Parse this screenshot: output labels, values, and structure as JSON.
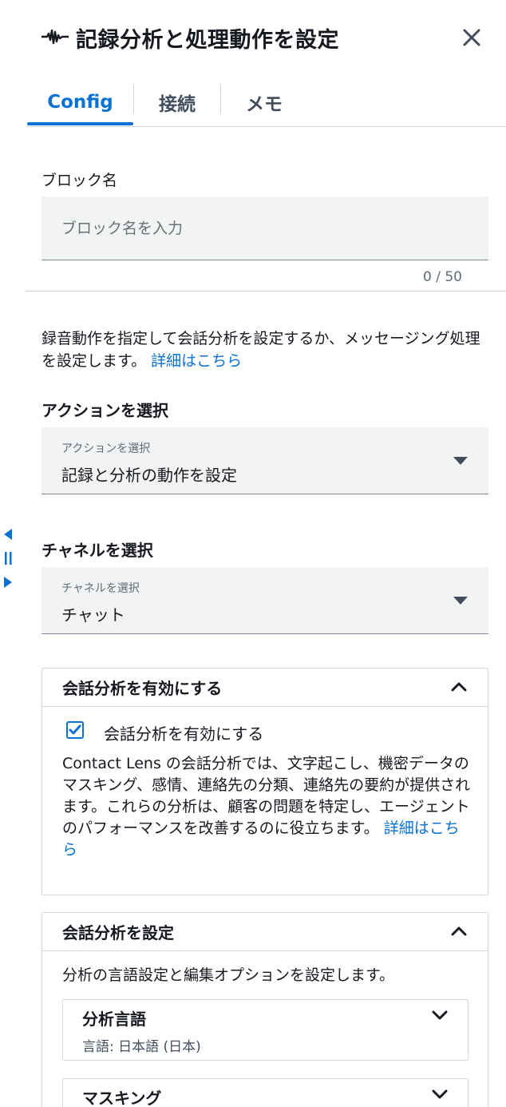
{
  "header": {
    "icon": "waveform-icon",
    "title": "記録分析と処理動作を設定",
    "close_icon": "close-icon"
  },
  "tabs": [
    {
      "label": "Config",
      "active": true
    },
    {
      "label": "接続",
      "active": false
    },
    {
      "label": "メモ",
      "active": false
    }
  ],
  "block_name": {
    "label": "ブロック名",
    "placeholder": "ブロック名を入力",
    "value": "",
    "counter": "0 / 50"
  },
  "description": {
    "text": "録音動作を指定して会話分析を設定するか、メッセージング処理を設定します。",
    "link": "詳細はこちら"
  },
  "action": {
    "heading": "アクションを選択",
    "select_label": "アクションを選択",
    "value": "記録と分析の動作を設定"
  },
  "channel": {
    "heading": "チャネルを選択",
    "select_label": "チャネルを選択",
    "value": "チャット"
  },
  "enable_section": {
    "title": "会話分析を有効にする",
    "checkbox_label": "会話分析を有効にする",
    "checked": true,
    "text": "Contact Lens の会話分析では、文字起こし、機密データのマスキング、感情、連絡先の分類、連絡先の要約が提供されます。これらの分析は、顧客の問題を特定し、エージェントのパフォーマンスを改善するのに役立ちます。",
    "link": "詳細はこちら"
  },
  "configure_section": {
    "title": "会話分析を設定",
    "description": "分析の言語設定と編集オプションを設定します。",
    "subsections": [
      {
        "title": "分析言語",
        "value": "言語: 日本語 (日本)"
      },
      {
        "title": "マスキング",
        "value": ""
      }
    ]
  },
  "colors": {
    "accent": "#0972d3",
    "text": "#16191f",
    "input_bg": "#f2f3f3",
    "border": "#d5dbdb"
  }
}
